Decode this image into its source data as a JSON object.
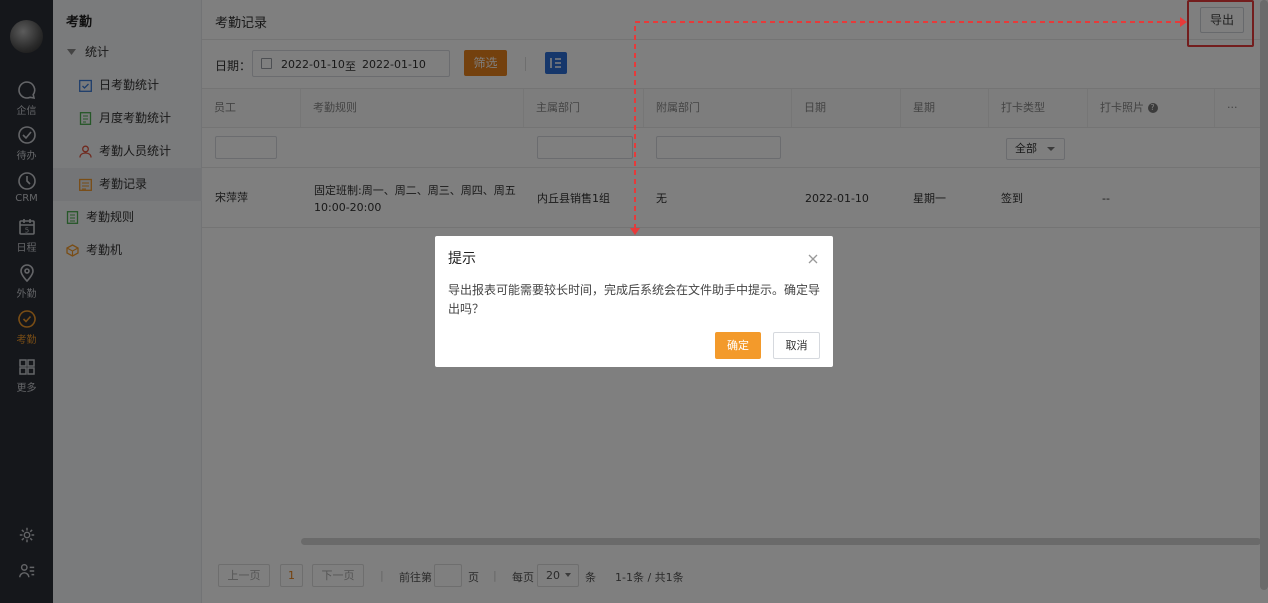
{
  "rail": {
    "items": [
      {
        "label": "企信",
        "icon": "chat-icon"
      },
      {
        "label": "待办",
        "icon": "check-circle-icon"
      },
      {
        "label": "CRM",
        "icon": "clock-icon"
      },
      {
        "label": "日程",
        "icon": "calendar-icon",
        "badge": "5"
      },
      {
        "label": "外勤",
        "icon": "location-pin-icon"
      },
      {
        "label": "考勤",
        "icon": "shield-check-icon"
      },
      {
        "label": "更多",
        "icon": "grid-icon"
      }
    ],
    "active": "考勤",
    "accent": "#f39a2b"
  },
  "subnav": {
    "title": "考勤",
    "group": "统计",
    "items": [
      {
        "label": "日考勤统计",
        "icon": "calendar-check-icon"
      },
      {
        "label": "月度考勤统计",
        "icon": "document-icon"
      },
      {
        "label": "考勤人员统计",
        "icon": "person-icon"
      },
      {
        "label": "考勤记录",
        "icon": "list-icon"
      },
      {
        "label": "考勤规则",
        "icon": "rules-icon"
      },
      {
        "label": "考勤机",
        "icon": "device-icon"
      }
    ],
    "selected": "考勤记录"
  },
  "header": {
    "title": "考勤记录",
    "export_label": "导出"
  },
  "filter": {
    "date_label": "日期：",
    "date_from": "2022-01-10",
    "date_to_word": "至",
    "date_to": "2022-01-10",
    "filter_label": "筛选"
  },
  "table": {
    "columns": [
      "员工",
      "考勤规则",
      "主属部门",
      "附属部门",
      "日期",
      "星期",
      "打卡类型",
      "打卡照片",
      "···"
    ],
    "type_filter": "全部",
    "rows": [
      {
        "employee": "宋萍萍",
        "rule_line1": "固定班制:周一、周二、周三、周四、周五",
        "rule_line2": "10:00-20:00",
        "main_dept": "内丘县销售1组",
        "sub_dept": "无",
        "date": "2022-01-10",
        "weekday": "星期一",
        "punch_type": "签到",
        "photo": "--"
      }
    ]
  },
  "pager": {
    "prev": "上一页",
    "current": "1",
    "next": "下一页",
    "goto_label": "前往第",
    "page_unit": "页",
    "per_page_label": "每页",
    "per_page": "20",
    "per_page_unit": "条",
    "summary": "1-1条 / 共1条"
  },
  "dialog": {
    "title": "提示",
    "message": "导出报表可能需要较长时间，完成后系统会在文件助手中提示。确定导出吗？",
    "ok_label": "确定",
    "cancel_label": "取消"
  }
}
